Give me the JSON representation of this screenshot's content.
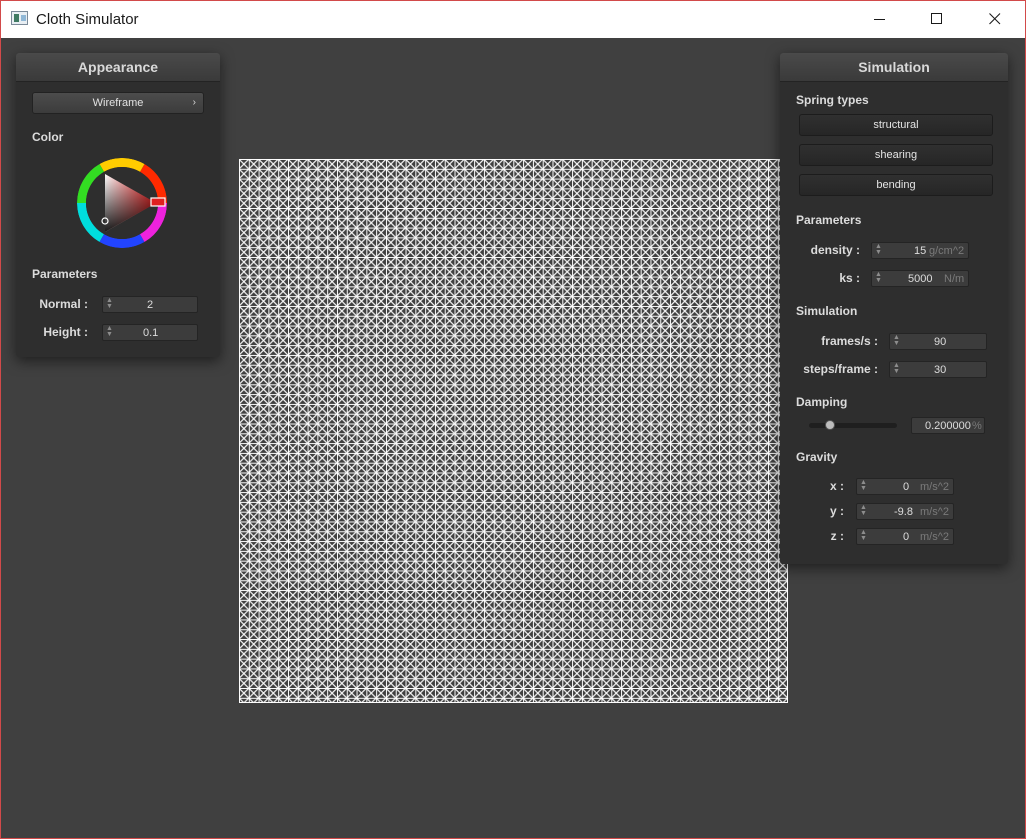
{
  "window": {
    "title": "Cloth Simulator",
    "controls": [
      "minimize-icon",
      "maximize-icon",
      "close-icon"
    ]
  },
  "appearance": {
    "title": "Appearance",
    "shader_selected": "Wireframe",
    "color_label": "Color",
    "parameters_label": "Parameters",
    "normal": {
      "label": "Normal :",
      "value": "2"
    },
    "height": {
      "label": "Height :",
      "value": "0.1"
    }
  },
  "simulation": {
    "title": "Simulation",
    "spring_types_label": "Spring types",
    "spring_types": [
      "structural",
      "shearing",
      "bending"
    ],
    "parameters_label": "Parameters",
    "density": {
      "label": "density :",
      "value": "15",
      "unit": "g/cm^2"
    },
    "ks": {
      "label": "ks :",
      "value": "5000",
      "unit": "N/m"
    },
    "simulation_label": "Simulation",
    "frames": {
      "label": "frames/s :",
      "value": "90"
    },
    "steps": {
      "label": "steps/frame :",
      "value": "30"
    },
    "damping_label": "Damping",
    "damping": {
      "value": "0.200000",
      "unit": "%",
      "slider_fraction": 0.2
    },
    "gravity_label": "Gravity",
    "gravity": [
      {
        "label": "x :",
        "value": "0",
        "unit": "m/s^2"
      },
      {
        "label": "y :",
        "value": "-9.8",
        "unit": "m/s^2"
      },
      {
        "label": "z :",
        "value": "0",
        "unit": "m/s^2"
      }
    ]
  },
  "colors": {
    "background": "#404040",
    "panel": "#2e2e2e",
    "wireframe": "#ffffff",
    "selected_color": "#e02020"
  }
}
